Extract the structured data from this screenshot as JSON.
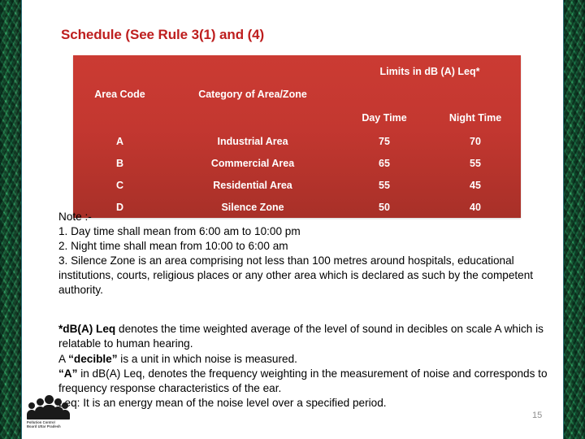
{
  "slide": {
    "title": "Schedule (See Rule 3(1) and (4)",
    "page_number": "15",
    "accent_red": "#BE1E1E",
    "table_red": "#C33730",
    "edge_green": "#1d6b42"
  },
  "table": {
    "headers": {
      "area_code": "Area Code",
      "category": "Category of Area/Zone",
      "limits_group": "Limits in dB (A) Leq*",
      "day_time": "Day Time",
      "night_time": "Night Time"
    },
    "rows": [
      {
        "code": "A",
        "category": "Industrial Area",
        "day": "75",
        "night": "70"
      },
      {
        "code": "B",
        "category": "Commercial Area",
        "day": "65",
        "night": "55"
      },
      {
        "code": "C",
        "category": "Residential Area",
        "day": "55",
        "night": "45"
      },
      {
        "code": "D",
        "category": "Silence Zone",
        "day": "50",
        "night": "40"
      }
    ]
  },
  "notes": {
    "heading": "Note :-",
    "item1": "1. Day time shall mean from 6:00 am to 10:00 pm",
    "item2": "2. Night time shall mean from 10:00 to 6:00 am",
    "item3": "3. Silence Zone is an area comprising not less than 100 metres around hospitals, educational institutions, courts, religious places or any other area which is declared as such by the competent authority."
  },
  "definitions": {
    "leq_term": "*dB(A) Leq",
    "leq_text": " denotes the time weighted average of the level of sound in decibles on scale A which is relatable to human hearing.",
    "decible_prefix": "A ",
    "decible_term": "“decible”",
    "decible_text": " is a unit in which noise is measured.",
    "a_term": "“A”",
    "a_text": " in dB(A) Leq, denotes the frequency weighting in the measurement of noise and corresponds to frequency response characteristics of the ear.",
    "leq_energy": "Leq: It is an energy mean of the noise level over a specified period."
  },
  "logo": {
    "caption_line1": "Pollution Control",
    "caption_line2": "Board Uttar Pradesh"
  }
}
